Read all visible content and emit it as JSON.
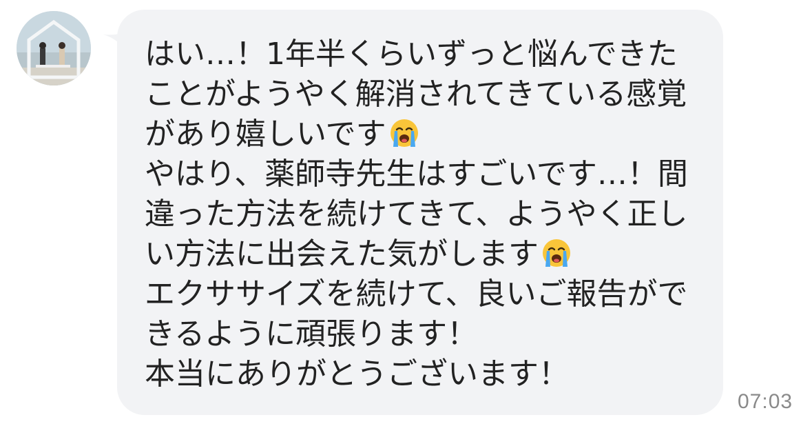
{
  "message": {
    "lines": [
      "はい…！1年半くらいずっと悩んできた",
      "ことがようやく解消されてきている感覚",
      "があり嬉しいです",
      "やはり、薬師寺先生はすごいです…！間",
      "違った方法を続けてきて、ようやく正し",
      "い方法に出会えた気がします",
      "エクササイズを続けて、良いご報告がで",
      "きるように頑張ります！",
      "本当にありがとうございます！"
    ],
    "emoji": "loudly-crying-face",
    "time": "07:03"
  },
  "colors": {
    "bubble": "#f2f3f5",
    "text": "#222222",
    "time": "#8a8a8a"
  }
}
